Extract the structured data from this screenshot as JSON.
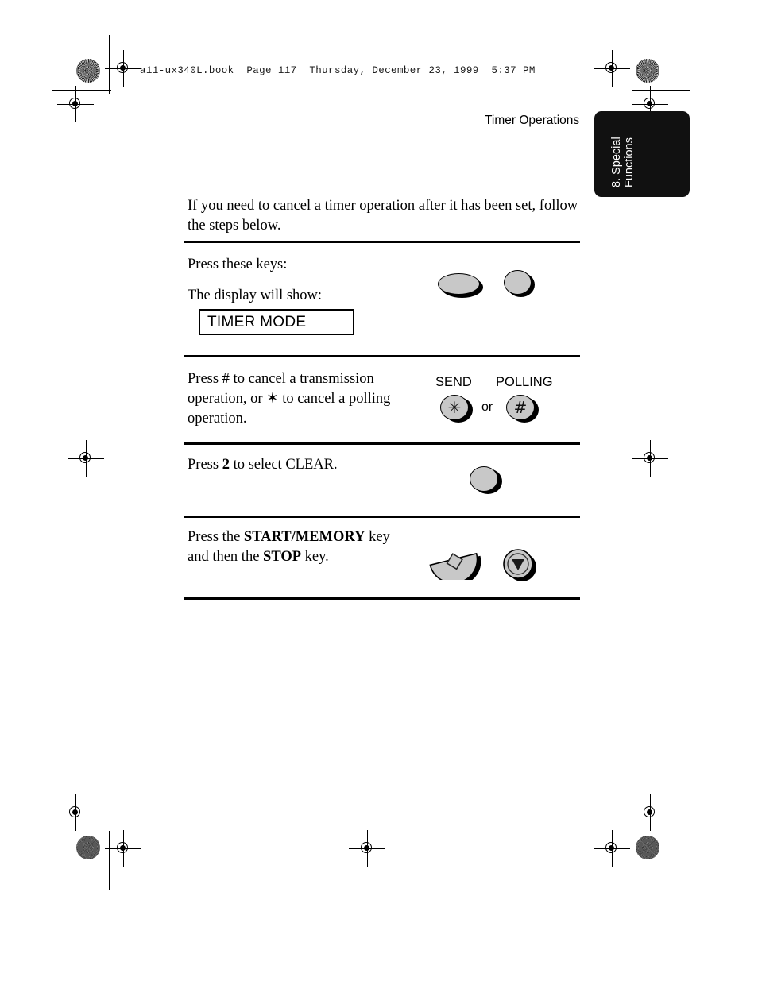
{
  "page": {
    "file_header": "a11-ux340L.book  Page 117  Thursday, December 23, 1999  5:37 PM",
    "running_head": "Timer Operations",
    "thumb_tab": {
      "line1": "8. Special",
      "line2": "Functions"
    }
  },
  "intro": {
    "text": "If you need to cancel a timer operation after it has been set, follow the steps below."
  },
  "steps": [
    {
      "id": "step-press-keys",
      "line1": "Press these keys:",
      "line2": "The display will show:",
      "lcd_value": "TIMER MODE",
      "keys": [
        {
          "name": "oval-key-left",
          "glyph": ""
        },
        {
          "name": "round-key-right",
          "glyph": ""
        }
      ]
    },
    {
      "id": "step-cancel-type",
      "text_part1": "Press # to cancel a transmission operation, or ",
      "text_star": "✶",
      "text_part2": " to cancel a polling operation.",
      "label_send": "SEND",
      "label_polling": "POLLING",
      "or_label": "or",
      "key_star_glyph": "✳",
      "key_hash_glyph": "#"
    },
    {
      "id": "step-select-clear",
      "text_before": "Press ",
      "text_bold": "2",
      "text_after": " to select CLEAR."
    },
    {
      "id": "step-start-stop",
      "text_line1_before": "Press the ",
      "text_line1_bold": "START/MEMORY",
      "text_line1_after": " key",
      "text_line2_before": "and then the ",
      "text_line2_bold": "STOP",
      "text_line2_after": " key."
    }
  ],
  "colors": {
    "key_face": "#c8c8c8",
    "tab_background": "#111111",
    "ink": "#000000"
  }
}
